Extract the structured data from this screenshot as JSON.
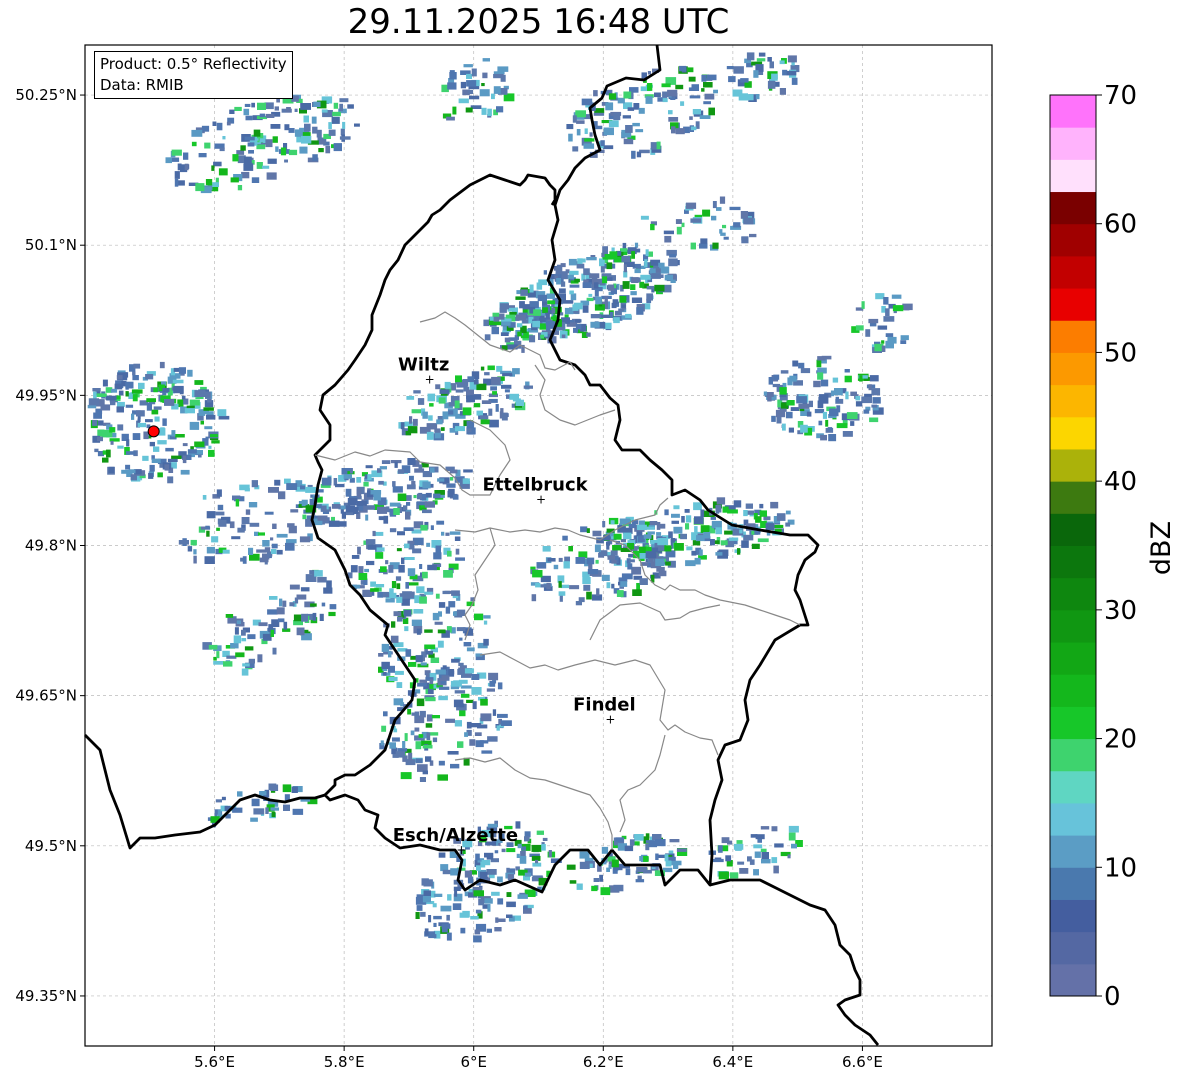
{
  "title": "29.11.2025 16:48 UTC",
  "info_box": {
    "product": "Product: 0.5° Reflectivity",
    "data": "Data: RMIB"
  },
  "map": {
    "lon_range": [
      5.4,
      6.8
    ],
    "lat_range": [
      49.3,
      50.3
    ],
    "x_ticks": [
      {
        "value": 5.6,
        "label": "5.6°E"
      },
      {
        "value": 5.8,
        "label": "5.8°E"
      },
      {
        "value": 6.0,
        "label": "6°E"
      },
      {
        "value": 6.2,
        "label": "6.2°E"
      },
      {
        "value": 6.4,
        "label": "6.4°E"
      },
      {
        "value": 6.6,
        "label": "6.6°E"
      }
    ],
    "y_ticks": [
      {
        "value": 49.35,
        "label": "49.35°N"
      },
      {
        "value": 49.5,
        "label": "49.5°N"
      },
      {
        "value": 49.65,
        "label": "49.65°N"
      },
      {
        "value": 49.8,
        "label": "49.8°N"
      },
      {
        "value": 49.95,
        "label": "49.95°N"
      },
      {
        "value": 50.1,
        "label": "50.1°N"
      },
      {
        "value": 50.25,
        "label": "50.25°N"
      }
    ],
    "grid": true,
    "radar_site": {
      "lon": 5.506,
      "lat": 49.914,
      "color": "#ff0000"
    },
    "cities": [
      {
        "name": "Wiltz",
        "lon": 5.932,
        "lat": 49.966
      },
      {
        "name": "Ettelbruck",
        "lon": 6.104,
        "lat": 49.846
      },
      {
        "name": "Findel",
        "lon": 6.211,
        "lat": 49.626
      },
      {
        "name": "Esch/Alzette",
        "lon": 5.981,
        "lat": 49.496
      }
    ]
  },
  "colorbar": {
    "label": "dBZ",
    "min": 0,
    "max": 70,
    "step": 2.5,
    "ticks": [
      "0",
      "10",
      "20",
      "30",
      "40",
      "50",
      "60",
      "70"
    ],
    "colors": [
      "#6471a8",
      "#5468a3",
      "#445e9f",
      "#4a79ae",
      "#5b9dc5",
      "#67c3da",
      "#5fd6c2",
      "#3ed36e",
      "#17c729",
      "#14b71c",
      "#12a715",
      "#109712",
      "#0e870f",
      "#0c770d",
      "#0a670b",
      "#3d7a10",
      "#abb20a",
      "#fcd600",
      "#fcb600",
      "#fc9900",
      "#fc7d00",
      "#e80000",
      "#c20000",
      "#a00000",
      "#7a0000",
      "#ffe0fc",
      "#ffb3fc",
      "#ff73fb",
      "#e844ef"
    ]
  }
}
